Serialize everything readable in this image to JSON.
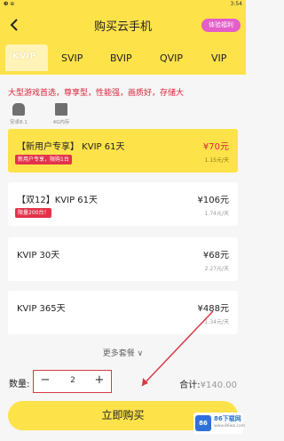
{
  "status_bar": {
    "left": "❸ ⊕",
    "time": "3:54"
  },
  "header": {
    "title": "购买云手机",
    "badge": "体验福利"
  },
  "tabs": [
    {
      "label": "KVIP",
      "active": true
    },
    {
      "label": "SVIP",
      "active": false
    },
    {
      "label": "BVIP",
      "active": false
    },
    {
      "label": "QVIP",
      "active": false
    },
    {
      "label": "VIP",
      "active": false
    }
  ],
  "description": "大型游戏首选，尊享型，性能强，画质好，存储大",
  "specs": [
    {
      "icon": "android-icon",
      "label": "安卓8.1"
    },
    {
      "icon": "storage-icon",
      "label": "4G内存"
    }
  ],
  "products": [
    {
      "name": "【新用户专享】 KVIP 61天",
      "price": "¥70元",
      "per_day": "1.15元/天",
      "promo": "新用户专享，限购1台",
      "selected": true
    },
    {
      "name": "【双12】KVIP 61天",
      "price": "¥106元",
      "per_day": "1.74元/天",
      "promo": "限量200台！",
      "selected": false
    },
    {
      "name": "KVIP 30天",
      "price": "¥68元",
      "per_day": "2.27元/天",
      "promo": "",
      "selected": false
    },
    {
      "name": "KVIP 365天",
      "price": "¥488元",
      "per_day": "1.34元/天",
      "promo": "",
      "selected": false
    }
  ],
  "more_plans": "更多套餐 ∨",
  "quantity": {
    "label": "数量:",
    "value": "2",
    "minus": "−",
    "plus": "+"
  },
  "total": {
    "label": "合计:",
    "amount": "¥140.00"
  },
  "buy_button": "立即购买",
  "watermark": {
    "icon_text": "86",
    "title": "86下载网",
    "sub": "www.86wk.com"
  },
  "colors": {
    "accent": "#fde24a",
    "price_red": "#d8243a",
    "highlight_border": "#d93a45"
  }
}
